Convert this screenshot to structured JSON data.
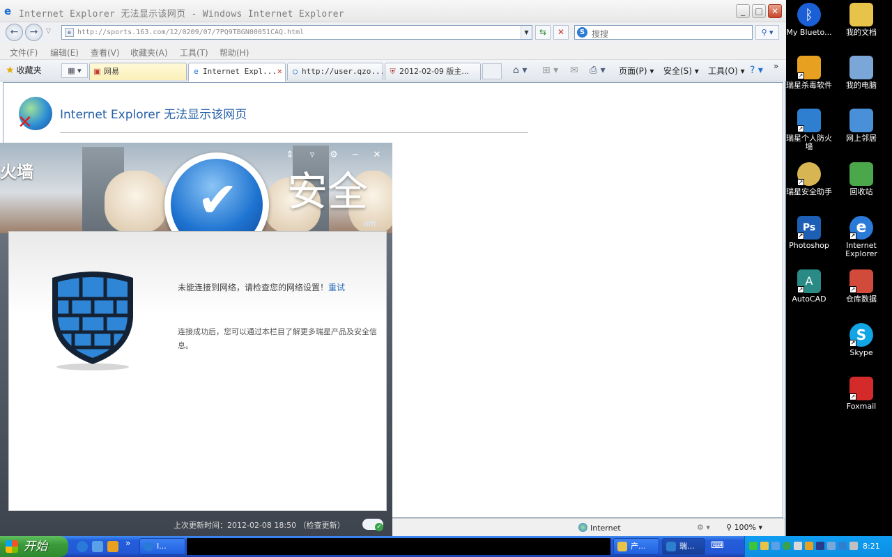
{
  "window": {
    "title": "Internet Explorer 无法显示该网页 - Windows Internet Explorer",
    "url": "http://sports.163.com/12/0209/07/7PQ9TBGN00051CAQ.html",
    "search_placeholder": "搜搜"
  },
  "menu": [
    "文件(F)",
    "编辑(E)",
    "查看(V)",
    "收藏夹(A)",
    "工具(T)",
    "帮助(H)"
  ],
  "favorites_label": "收藏夹",
  "tabs": [
    {
      "label": "网易",
      "active": false
    },
    {
      "label": "Internet Expl...",
      "active": true
    },
    {
      "label": "http://user.qzo...",
      "active": false
    },
    {
      "label": "2012-02-09 版主...",
      "active": false
    }
  ],
  "commands": {
    "page": "页面(P)",
    "safety": "安全(S)",
    "tools": "工具(O)"
  },
  "error": {
    "title": "Internet Explorer 无法显示该网页"
  },
  "statusbar": {
    "zone": "Internet",
    "zoom": "100%"
  },
  "firewall": {
    "brand": "防火墙",
    "status": "安全",
    "offline": "offl",
    "message": "未能连接到网络，请检查您的网络设置！",
    "retry": "重试",
    "tip": "连接成功后，您可以通过本栏目了解更多瑞星产品及安全信息。",
    "last_update": "上次更新时间：2012-02-08 18:50",
    "check_update": "（检查更新）"
  },
  "desktop_icons": [
    {
      "label": "My Blueto...",
      "color": "#1b5fd6"
    },
    {
      "label": "我的文档",
      "color": "#e8c34a"
    },
    {
      "label": "瑞星杀毒软件",
      "color": "#e8a020"
    },
    {
      "label": "我的电脑",
      "color": "#7aa6d8"
    },
    {
      "label": "瑞星个人防火墙",
      "color": "#2f7fd0"
    },
    {
      "label": "网上邻居",
      "color": "#4a90d9"
    },
    {
      "label": "瑞星安全助手",
      "color": "#d7b552"
    },
    {
      "label": "回收站",
      "color": "#4aa84a"
    },
    {
      "label": "Photoshop",
      "color": "#1d5fb5"
    },
    {
      "label": "Internet Explorer",
      "color": "#2a7ad8"
    },
    {
      "label": "AutoCAD",
      "color": "#2a8a86"
    },
    {
      "label": "仓库数据",
      "color": "#d24a3a"
    },
    {
      "label": "Skype",
      "color": "#12a5e6"
    },
    {
      "label": "Foxmail",
      "color": "#d42a2a"
    }
  ],
  "taskbar": {
    "start": "开始",
    "tasks": [
      "I...",
      "产...",
      "瑞..."
    ],
    "clock": "8:21"
  }
}
